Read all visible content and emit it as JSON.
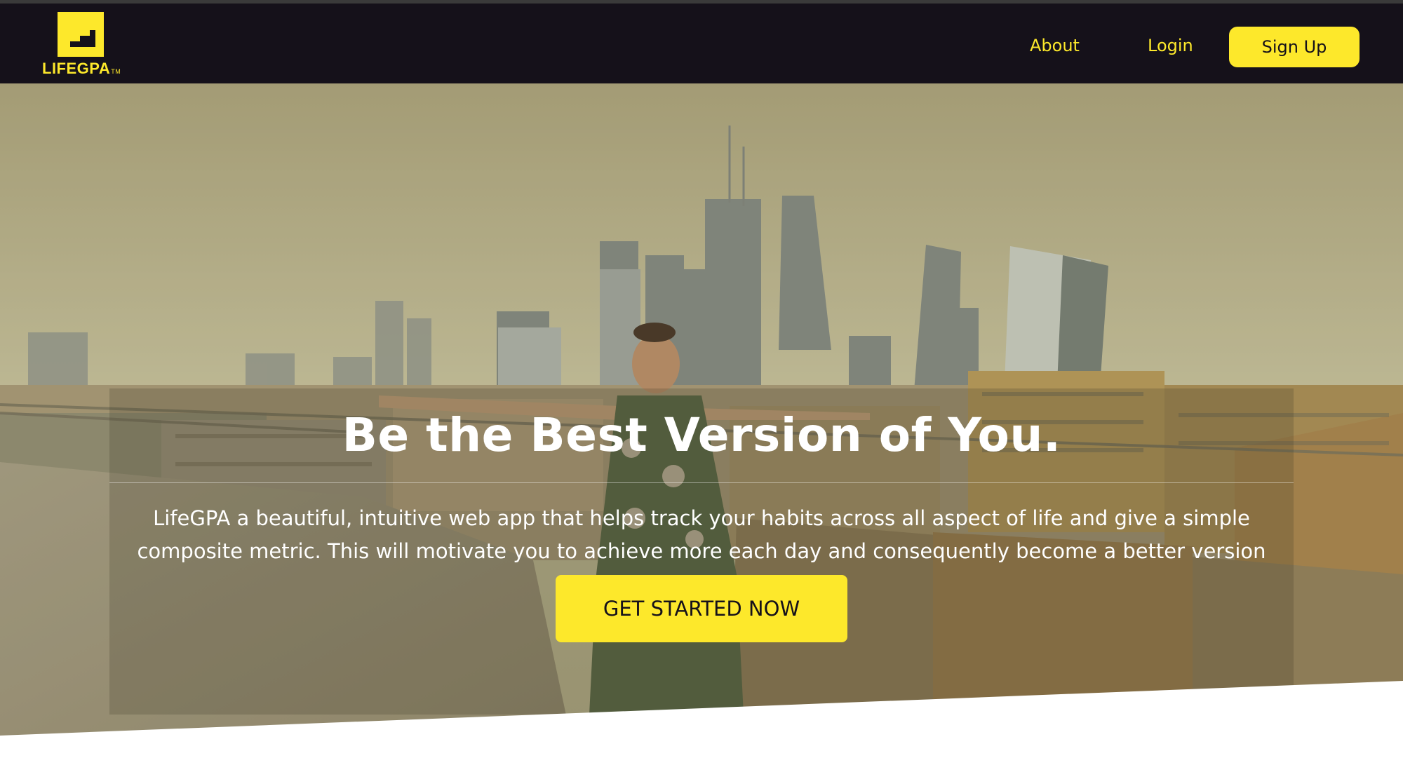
{
  "brand": {
    "name": "LIFEGPA",
    "trademark": "TM",
    "accent_color": "#fde82b",
    "nav_background": "#15111a"
  },
  "nav": {
    "about": "About",
    "login": "Login",
    "signup": "Sign Up"
  },
  "hero": {
    "title": "Be the Best Version of You.",
    "description": "LifeGPA a beautiful, intuitive web app that helps track your habits across all aspect of life and give a simple composite metric. This will motivate you to achieve more each day and consequently become a better version of yourself",
    "cta": "GET STARTED NOW",
    "background": "photo of a woman doing a yoga pose on a rooftop terrace with a city skyline"
  }
}
